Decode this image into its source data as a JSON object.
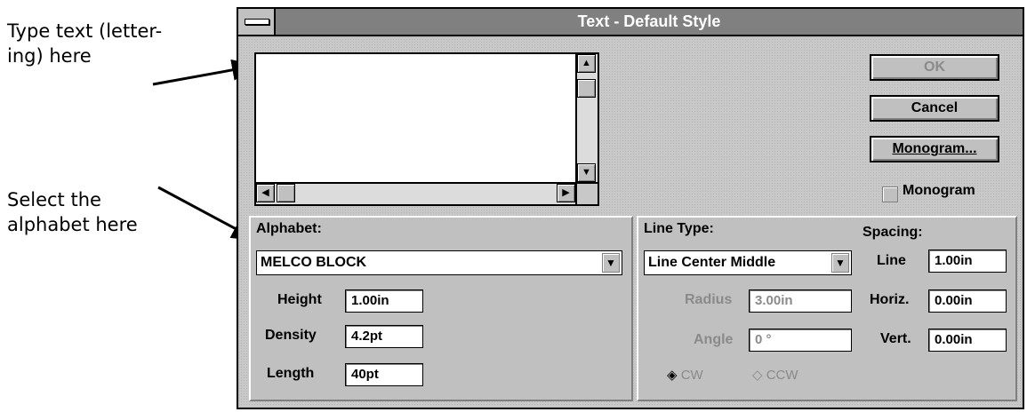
{
  "annotations": {
    "type_text": "Type text (letter-\ning) here",
    "select_alphabet": "Select the\nalphabet here"
  },
  "dialog": {
    "title": "Text - Default Style",
    "buttons": {
      "ok": "OK",
      "cancel": "Cancel",
      "monogram": "Monogram..."
    },
    "monogram_checkbox": {
      "label": "Monogram",
      "checked": false
    }
  },
  "alphabet": {
    "label": "Alphabet:",
    "selected": "MELCO BLOCK",
    "height_label": "Height",
    "height_value": "1.00in",
    "density_label": "Density",
    "density_value": "4.2pt",
    "length_label": "Length",
    "length_value": "40pt"
  },
  "line_type": {
    "label": "Line Type:",
    "selected": "Line Center Middle",
    "radius_label": "Radius",
    "radius_value": "3.00in",
    "angle_label": "Angle",
    "angle_value": "0 °",
    "cw_label": "CW",
    "ccw_label": "CCW",
    "direction_selected": "CW"
  },
  "spacing": {
    "label": "Spacing:",
    "line_label": "Line",
    "line_value": "1.00in",
    "horiz_label": "Horiz.",
    "horiz_value": "0.00in",
    "vert_label": "Vert.",
    "vert_value": "0.00in"
  },
  "icons": [
    "system-menu-icon",
    "scroll-up-arrow-icon",
    "scroll-down-arrow-icon",
    "scroll-left-arrow-icon",
    "scroll-right-arrow-icon",
    "dropdown-arrow-icon"
  ]
}
